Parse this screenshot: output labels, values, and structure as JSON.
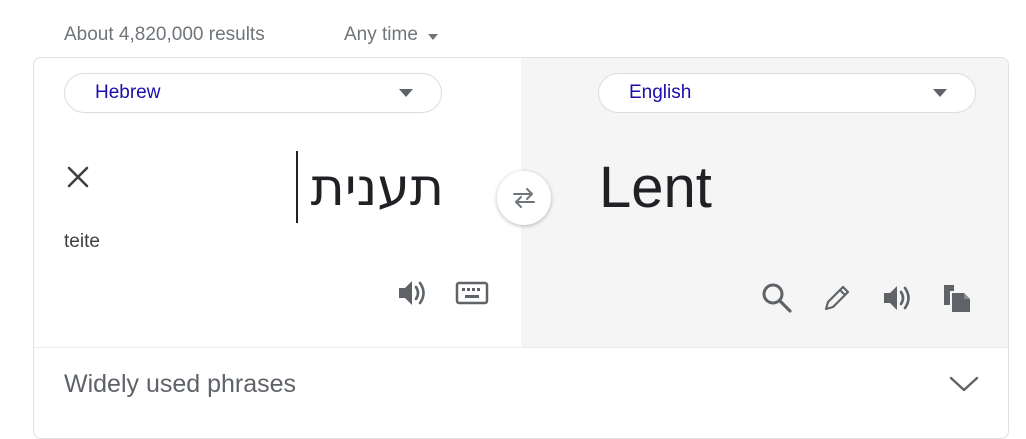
{
  "search_stats": {
    "results_text": "About 4,820,000 results"
  },
  "time_filter": {
    "label": "Any time"
  },
  "translator": {
    "source_language": "Hebrew",
    "target_language": "English",
    "source_text": "תענית",
    "transliteration": "teite",
    "translated_text": "Lent",
    "widely_used_phrases_label": "Widely used phrases"
  },
  "icons": {
    "clear": "close-icon",
    "swap": "swap-icon",
    "source_speak": "speaker-icon",
    "keyboard": "keyboard-icon",
    "search": "search-icon",
    "edit": "pencil-icon",
    "target_speak": "speaker-icon",
    "copy": "copy-icon",
    "expand": "chevron-down-icon"
  },
  "colors": {
    "language_link": "#1a0dab",
    "target_pane_bg": "#f5f5f5",
    "icon_gray": "#5f6368"
  }
}
